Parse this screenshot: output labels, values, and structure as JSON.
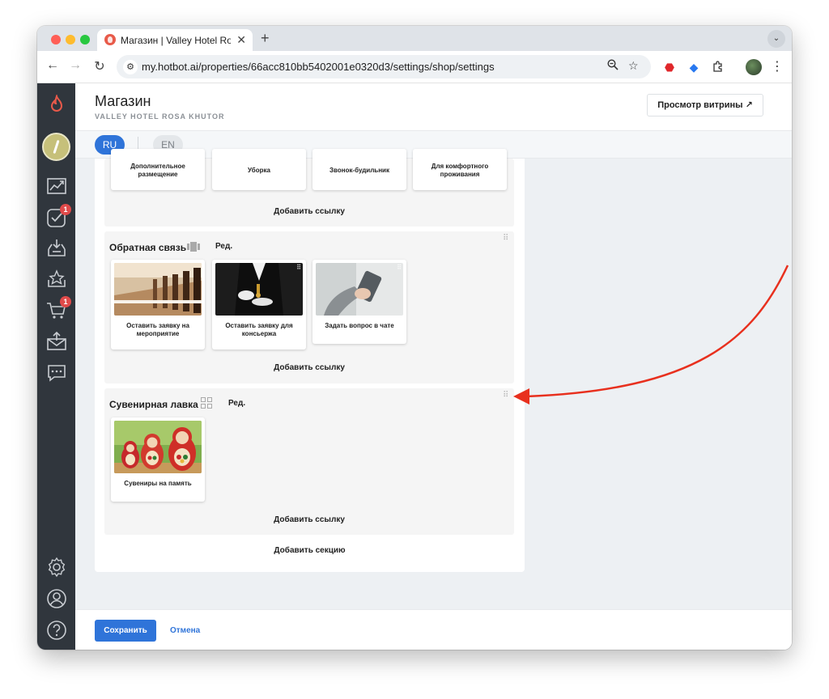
{
  "browser": {
    "tab_title": "Магазин | Valley Hotel Rosa Khutor",
    "tab_close": "✕",
    "new_tab": "+",
    "tab_menu": "⌄",
    "url_host": "my.hotbot.ai",
    "url_path": "/properties/66acc810bb5402001e0320d3/settings/shop/settings",
    "back": "←",
    "forward": "→",
    "reload": "↻"
  },
  "header": {
    "title": "Магазин",
    "subtitle": "VALLEY HOTEL ROSA KHUTOR",
    "preview_label": "Просмотр витрины ↗"
  },
  "languages": [
    "RU",
    "EN"
  ],
  "sidebar": {
    "badges": {
      "tasks": "1",
      "cart": "1"
    }
  },
  "sections": [
    {
      "title": "",
      "tiles": [
        {
          "label": "Дополнительное размещение"
        },
        {
          "label": "Уборка"
        },
        {
          "label": "Звонок-будильник"
        },
        {
          "label": "Для комфортного проживания"
        }
      ],
      "add_link": "Добавить ссылку"
    },
    {
      "title": "Обратная связь",
      "edit": "Ред.",
      "tiles": [
        {
          "label": "Оставить заявку на мероприятие"
        },
        {
          "label": "Оставить заявку для консьержа"
        },
        {
          "label": "Задать вопрос в чате"
        }
      ],
      "add_link": "Добавить ссылку"
    },
    {
      "title": "Сувенирная лавка",
      "edit": "Ред.",
      "tiles": [
        {
          "label": "Сувениры на память"
        }
      ],
      "add_link": "Добавить ссылку"
    }
  ],
  "add_section": "Добавить секцию",
  "footer": {
    "save": "Сохранить",
    "cancel": "Отмена"
  },
  "colors": {
    "accent": "#2f74d9",
    "sidebar": "#30363d",
    "badge": "#e04a4a",
    "annotation_arrow": "#e8301e"
  }
}
